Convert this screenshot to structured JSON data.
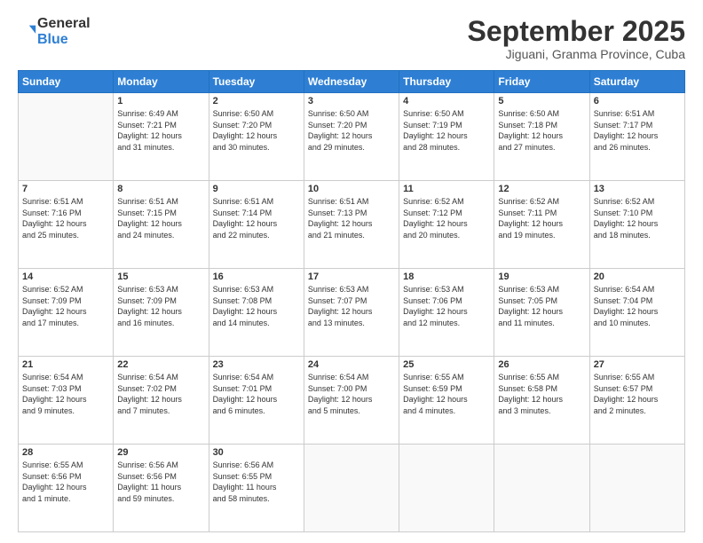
{
  "logo": {
    "general": "General",
    "blue": "Blue"
  },
  "title": "September 2025",
  "subtitle": "Jiguani, Granma Province, Cuba",
  "weekdays": [
    "Sunday",
    "Monday",
    "Tuesday",
    "Wednesday",
    "Thursday",
    "Friday",
    "Saturday"
  ],
  "weeks": [
    [
      {
        "day": "",
        "info": ""
      },
      {
        "day": "1",
        "info": "Sunrise: 6:49 AM\nSunset: 7:21 PM\nDaylight: 12 hours\nand 31 minutes."
      },
      {
        "day": "2",
        "info": "Sunrise: 6:50 AM\nSunset: 7:20 PM\nDaylight: 12 hours\nand 30 minutes."
      },
      {
        "day": "3",
        "info": "Sunrise: 6:50 AM\nSunset: 7:20 PM\nDaylight: 12 hours\nand 29 minutes."
      },
      {
        "day": "4",
        "info": "Sunrise: 6:50 AM\nSunset: 7:19 PM\nDaylight: 12 hours\nand 28 minutes."
      },
      {
        "day": "5",
        "info": "Sunrise: 6:50 AM\nSunset: 7:18 PM\nDaylight: 12 hours\nand 27 minutes."
      },
      {
        "day": "6",
        "info": "Sunrise: 6:51 AM\nSunset: 7:17 PM\nDaylight: 12 hours\nand 26 minutes."
      }
    ],
    [
      {
        "day": "7",
        "info": "Sunrise: 6:51 AM\nSunset: 7:16 PM\nDaylight: 12 hours\nand 25 minutes."
      },
      {
        "day": "8",
        "info": "Sunrise: 6:51 AM\nSunset: 7:15 PM\nDaylight: 12 hours\nand 24 minutes."
      },
      {
        "day": "9",
        "info": "Sunrise: 6:51 AM\nSunset: 7:14 PM\nDaylight: 12 hours\nand 22 minutes."
      },
      {
        "day": "10",
        "info": "Sunrise: 6:51 AM\nSunset: 7:13 PM\nDaylight: 12 hours\nand 21 minutes."
      },
      {
        "day": "11",
        "info": "Sunrise: 6:52 AM\nSunset: 7:12 PM\nDaylight: 12 hours\nand 20 minutes."
      },
      {
        "day": "12",
        "info": "Sunrise: 6:52 AM\nSunset: 7:11 PM\nDaylight: 12 hours\nand 19 minutes."
      },
      {
        "day": "13",
        "info": "Sunrise: 6:52 AM\nSunset: 7:10 PM\nDaylight: 12 hours\nand 18 minutes."
      }
    ],
    [
      {
        "day": "14",
        "info": "Sunrise: 6:52 AM\nSunset: 7:09 PM\nDaylight: 12 hours\nand 17 minutes."
      },
      {
        "day": "15",
        "info": "Sunrise: 6:53 AM\nSunset: 7:09 PM\nDaylight: 12 hours\nand 16 minutes."
      },
      {
        "day": "16",
        "info": "Sunrise: 6:53 AM\nSunset: 7:08 PM\nDaylight: 12 hours\nand 14 minutes."
      },
      {
        "day": "17",
        "info": "Sunrise: 6:53 AM\nSunset: 7:07 PM\nDaylight: 12 hours\nand 13 minutes."
      },
      {
        "day": "18",
        "info": "Sunrise: 6:53 AM\nSunset: 7:06 PM\nDaylight: 12 hours\nand 12 minutes."
      },
      {
        "day": "19",
        "info": "Sunrise: 6:53 AM\nSunset: 7:05 PM\nDaylight: 12 hours\nand 11 minutes."
      },
      {
        "day": "20",
        "info": "Sunrise: 6:54 AM\nSunset: 7:04 PM\nDaylight: 12 hours\nand 10 minutes."
      }
    ],
    [
      {
        "day": "21",
        "info": "Sunrise: 6:54 AM\nSunset: 7:03 PM\nDaylight: 12 hours\nand 9 minutes."
      },
      {
        "day": "22",
        "info": "Sunrise: 6:54 AM\nSunset: 7:02 PM\nDaylight: 12 hours\nand 7 minutes."
      },
      {
        "day": "23",
        "info": "Sunrise: 6:54 AM\nSunset: 7:01 PM\nDaylight: 12 hours\nand 6 minutes."
      },
      {
        "day": "24",
        "info": "Sunrise: 6:54 AM\nSunset: 7:00 PM\nDaylight: 12 hours\nand 5 minutes."
      },
      {
        "day": "25",
        "info": "Sunrise: 6:55 AM\nSunset: 6:59 PM\nDaylight: 12 hours\nand 4 minutes."
      },
      {
        "day": "26",
        "info": "Sunrise: 6:55 AM\nSunset: 6:58 PM\nDaylight: 12 hours\nand 3 minutes."
      },
      {
        "day": "27",
        "info": "Sunrise: 6:55 AM\nSunset: 6:57 PM\nDaylight: 12 hours\nand 2 minutes."
      }
    ],
    [
      {
        "day": "28",
        "info": "Sunrise: 6:55 AM\nSunset: 6:56 PM\nDaylight: 12 hours\nand 1 minute."
      },
      {
        "day": "29",
        "info": "Sunrise: 6:56 AM\nSunset: 6:56 PM\nDaylight: 11 hours\nand 59 minutes."
      },
      {
        "day": "30",
        "info": "Sunrise: 6:56 AM\nSunset: 6:55 PM\nDaylight: 11 hours\nand 58 minutes."
      },
      {
        "day": "",
        "info": ""
      },
      {
        "day": "",
        "info": ""
      },
      {
        "day": "",
        "info": ""
      },
      {
        "day": "",
        "info": ""
      }
    ]
  ]
}
